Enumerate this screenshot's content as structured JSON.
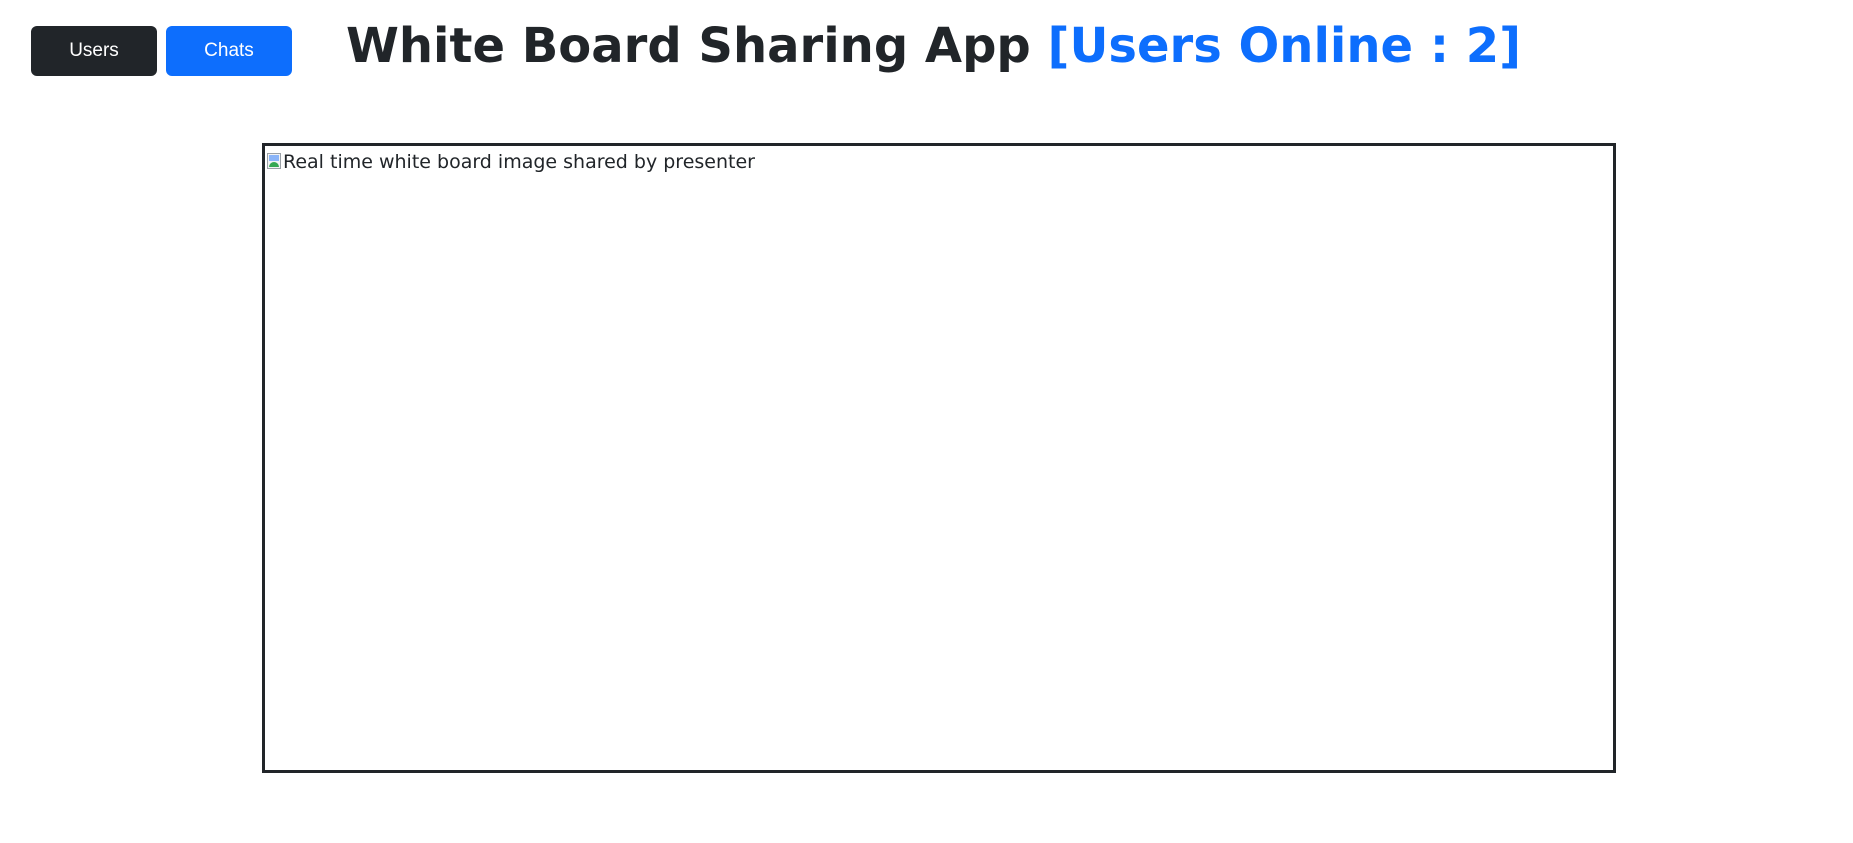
{
  "header": {
    "users_button": "Users",
    "chats_button": "Chats",
    "title": "White Board Sharing App",
    "users_online": "[Users Online : 2]"
  },
  "board": {
    "image_alt": "Real time white board image shared by presenter"
  },
  "colors": {
    "primary": "#0d6efd",
    "dark": "#212529",
    "background": "#ffffff"
  },
  "icons": {
    "broken_image": "broken-image-icon"
  }
}
